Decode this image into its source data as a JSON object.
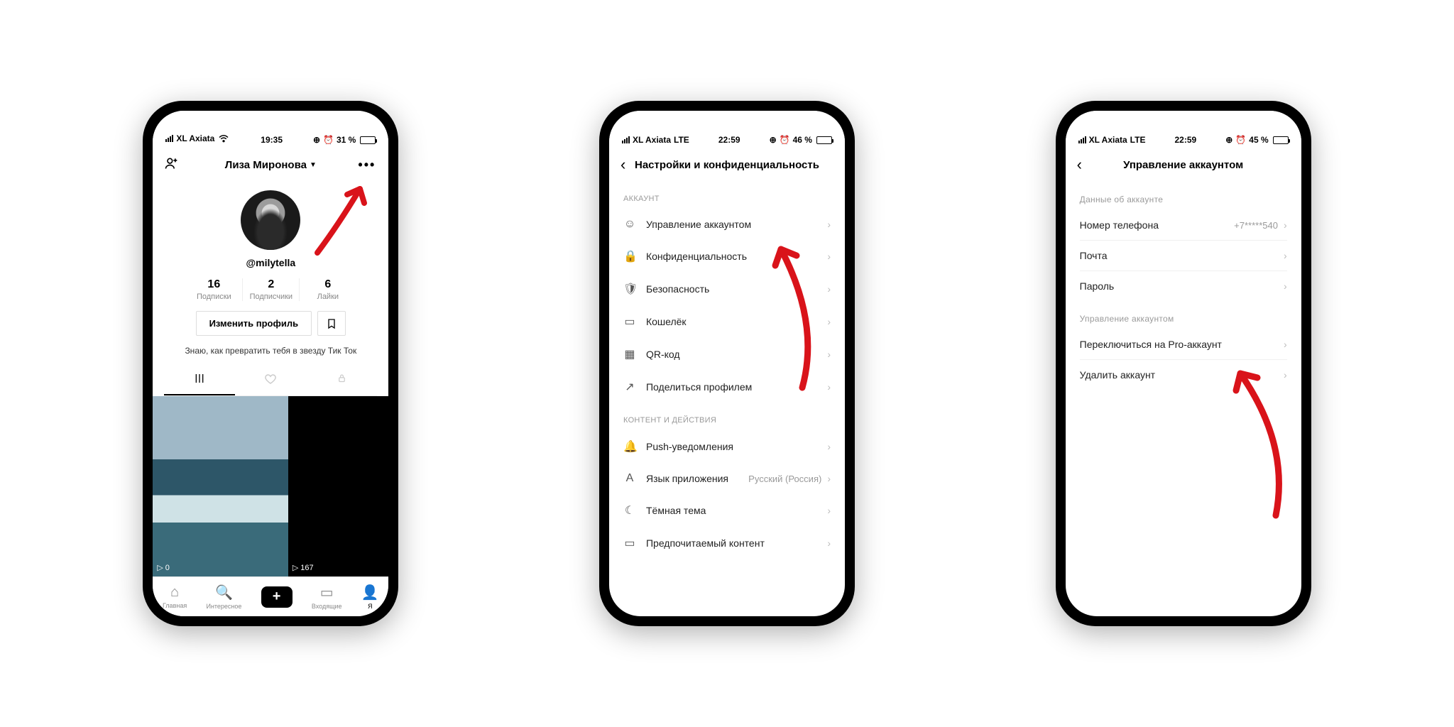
{
  "phone1": {
    "status": {
      "carrier": "XL Axiata",
      "net": "wifi",
      "time": "19:35",
      "battery_pct": "31 %",
      "battery_fill": 31
    },
    "header": {
      "name": "Лиза Миронова"
    },
    "profile": {
      "handle": "@milytella",
      "stats": [
        {
          "n": "16",
          "l": "Подписки"
        },
        {
          "n": "2",
          "l": "Подписчики"
        },
        {
          "n": "6",
          "l": "Лайки"
        }
      ],
      "edit_label": "Изменить профиль",
      "bio": "Знаю, как превратить тебя в звезду Тик Ток",
      "videos": [
        {
          "plays": "0"
        },
        {
          "plays": "167"
        }
      ]
    },
    "nav": {
      "home": "Главная",
      "discover": "Интересное",
      "inbox": "Входящие",
      "me": "Я"
    }
  },
  "phone2": {
    "status": {
      "carrier": "XL Axiata",
      "net": "LTE",
      "time": "22:59",
      "battery_pct": "46 %",
      "battery_fill": 46
    },
    "header": {
      "title": "Настройки и конфиденциальность"
    },
    "section1_label": "АККАУНТ",
    "rows1": [
      {
        "icon": "person",
        "label": "Управление аккаунтом"
      },
      {
        "icon": "lock",
        "label": "Конфиденциальность"
      },
      {
        "icon": "shield",
        "label": "Безопасность"
      },
      {
        "icon": "wallet",
        "label": "Кошелёк"
      },
      {
        "icon": "qr",
        "label": "QR-код"
      },
      {
        "icon": "share",
        "label": "Поделиться профилем"
      }
    ],
    "section2_label": "КОНТЕНТ И ДЕЙСТВИЯ",
    "rows2": [
      {
        "icon": "bell",
        "label": "Push-уведомления",
        "val": ""
      },
      {
        "icon": "lang",
        "label": "Язык приложения",
        "val": "Русский (Россия)"
      },
      {
        "icon": "moon",
        "label": "Тёмная тема",
        "val": ""
      },
      {
        "icon": "video",
        "label": "Предпочитаемый контент",
        "val": ""
      }
    ]
  },
  "phone3": {
    "status": {
      "carrier": "XL Axiata",
      "net": "LTE",
      "time": "22:59",
      "battery_pct": "45 %",
      "battery_fill": 45
    },
    "header": {
      "title": "Управление аккаунтом"
    },
    "section1_label": "Данные об аккаунте",
    "rows1": [
      {
        "label": "Номер телефона",
        "val": "+7*****540"
      },
      {
        "label": "Почта",
        "val": ""
      },
      {
        "label": "Пароль",
        "val": ""
      }
    ],
    "section2_label": "Управление аккаунтом",
    "rows2": [
      {
        "label": "Переключиться на Pro-аккаунт"
      },
      {
        "label": "Удалить аккаунт"
      }
    ]
  }
}
